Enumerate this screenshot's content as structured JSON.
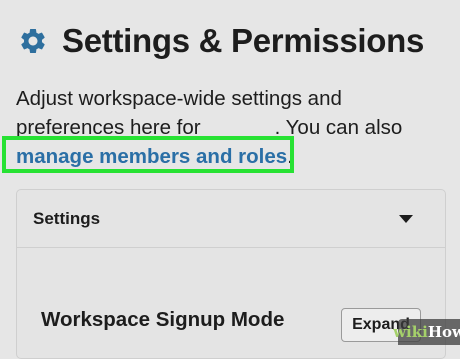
{
  "header": {
    "icon": "gear-icon",
    "title": "Settings & Permissions"
  },
  "description": {
    "line1": "Adjust workspace-wide settings and",
    "line2_start": "preferences here for",
    "line2_end": ". You can also",
    "link_text": "manage members and roles",
    "link_suffix": "."
  },
  "settings_card": {
    "title": "Settings",
    "row_label": "Workspace Signup Mode",
    "expand_label": "Expand"
  },
  "watermark": {
    "prefix": "wiki",
    "suffix": "How"
  },
  "colors": {
    "highlight": "#27e233",
    "link": "#2a6fa6",
    "gear": "#2e6f9e",
    "background": "#e6e6e6"
  }
}
